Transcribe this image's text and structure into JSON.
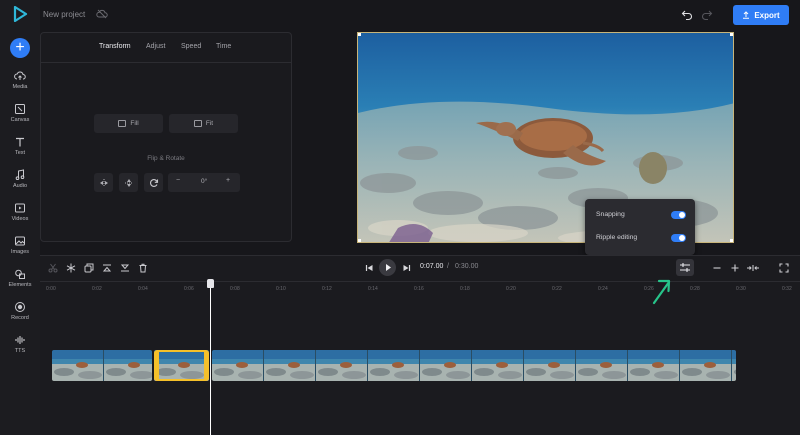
{
  "app": {
    "project_name": "New project",
    "export_label": "Export"
  },
  "rail": {
    "items": [
      {
        "label": "Media",
        "icon": "cloud-upload-icon"
      },
      {
        "label": "Canvas",
        "icon": "canvas-icon"
      },
      {
        "label": "Text",
        "icon": "text-icon"
      },
      {
        "label": "Audio",
        "icon": "music-icon"
      },
      {
        "label": "Videos",
        "icon": "video-icon"
      },
      {
        "label": "Images",
        "icon": "image-icon"
      },
      {
        "label": "Elements",
        "icon": "shapes-icon"
      },
      {
        "label": "Record",
        "icon": "record-icon"
      },
      {
        "label": "TTS",
        "icon": "waveform-icon"
      }
    ]
  },
  "panel": {
    "tabs": [
      "Transform",
      "Adjust",
      "Speed",
      "Time"
    ],
    "active_tab": "Transform",
    "fill_label": "Fill",
    "fit_label": "Fit",
    "flip_label": "Flip & Rotate",
    "rotation_value": "0°",
    "minus": "−",
    "plus": "+"
  },
  "popup": {
    "snapping_label": "Snapping",
    "snapping_on": true,
    "ripple_label": "Ripple editing",
    "ripple_on": true
  },
  "timeline": {
    "current_time": "0:07.00",
    "separator": "/",
    "total_time": "0:30.00",
    "ticks": [
      "0:00",
      "0:02",
      "0:04",
      "0:06",
      "0:08",
      "0:10",
      "0:12",
      "0:14",
      "0:16",
      "0:18",
      "0:20",
      "0:22",
      "0:24",
      "0:26",
      "0:28",
      "0:30",
      "0:32"
    ]
  },
  "colors": {
    "accent": "#2f7df6",
    "selection": "#f5c02a",
    "pointer_arrow": "#27c48a"
  }
}
